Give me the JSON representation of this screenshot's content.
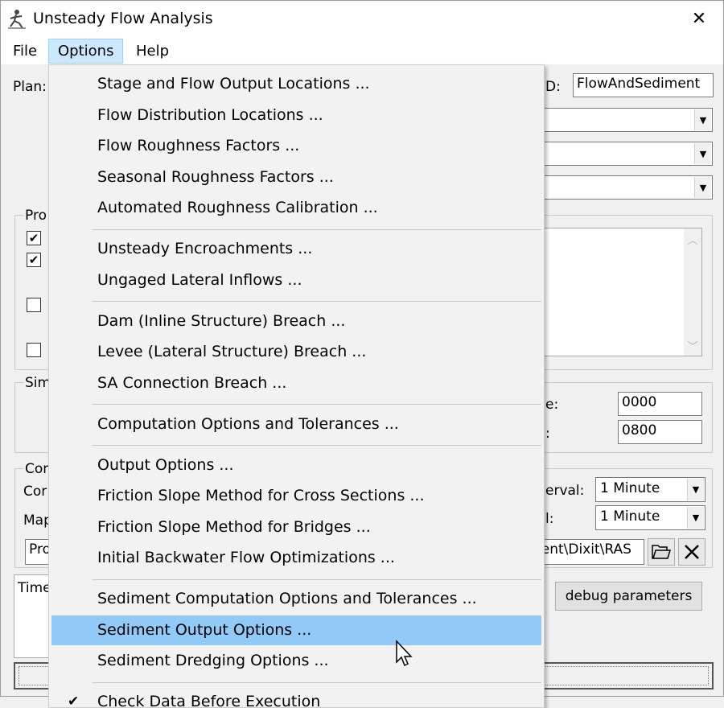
{
  "window": {
    "title": "Unsteady Flow Analysis",
    "close_glyph": "✕",
    "app_icon": "runner-icon"
  },
  "menubar": {
    "file": "File",
    "options": "Options",
    "help": "Help"
  },
  "plan": {
    "label": "Plan:",
    "id_label_fragment": "D:",
    "id_value": "FlowAndSediment"
  },
  "groups": {
    "programs_fragment": "Pro",
    "simulation_fragment": "Sim",
    "computation_fragment": "Cor",
    "computation_label_fragment": "Cor",
    "mapping_label_fragment": "Map",
    "computation_field_fragment": "Pro"
  },
  "checkboxes": [
    {
      "checked": true
    },
    {
      "checked": true
    },
    {
      "checked": false
    },
    {
      "checked": false
    }
  ],
  "simulation": {
    "row1_label_fragment": "e:",
    "row1_value": "0000",
    "row2_label_fragment": ":",
    "row2_value": "0800"
  },
  "computation": {
    "interval1_label_fragment": "erval:",
    "interval1_value": "1 Minute",
    "interval2_label_fragment": "l:",
    "interval2_value": "1 Minute",
    "path_fragment": "nent\\Dixit\\RAS"
  },
  "log": {
    "label_fragment": "Time",
    "debug_button": "debug parameters"
  },
  "options_menu": {
    "items": [
      {
        "label": "Stage and Flow Output Locations ..."
      },
      {
        "label": "Flow Distribution Locations ..."
      },
      {
        "label": "Flow Roughness Factors ..."
      },
      {
        "label": "Seasonal Roughness Factors ..."
      },
      {
        "label": "Automated Roughness Calibration ..."
      },
      {
        "label": "Unsteady Encroachments ..."
      },
      {
        "label": "Ungaged Lateral Inflows ..."
      },
      {
        "label": "Dam (Inline Structure) Breach ..."
      },
      {
        "label": "Levee (Lateral Structure) Breach ..."
      },
      {
        "label": "SA Connection Breach ..."
      },
      {
        "label": "Computation Options and Tolerances ..."
      },
      {
        "label": "Output Options ..."
      },
      {
        "label": "Friction Slope Method for Cross Sections ..."
      },
      {
        "label": "Friction Slope Method for Bridges ..."
      },
      {
        "label": "Initial Backwater Flow Optimizations ..."
      },
      {
        "label": "Sediment Computation Options and Tolerances ..."
      },
      {
        "label": "Sediment Output Options ..."
      },
      {
        "label": "Sediment Dredging Options ..."
      },
      {
        "label": "Check Data Before Execution"
      }
    ],
    "highlighted_item": "Sediment Output Options ...",
    "highlight_color": "#91c9f7"
  }
}
